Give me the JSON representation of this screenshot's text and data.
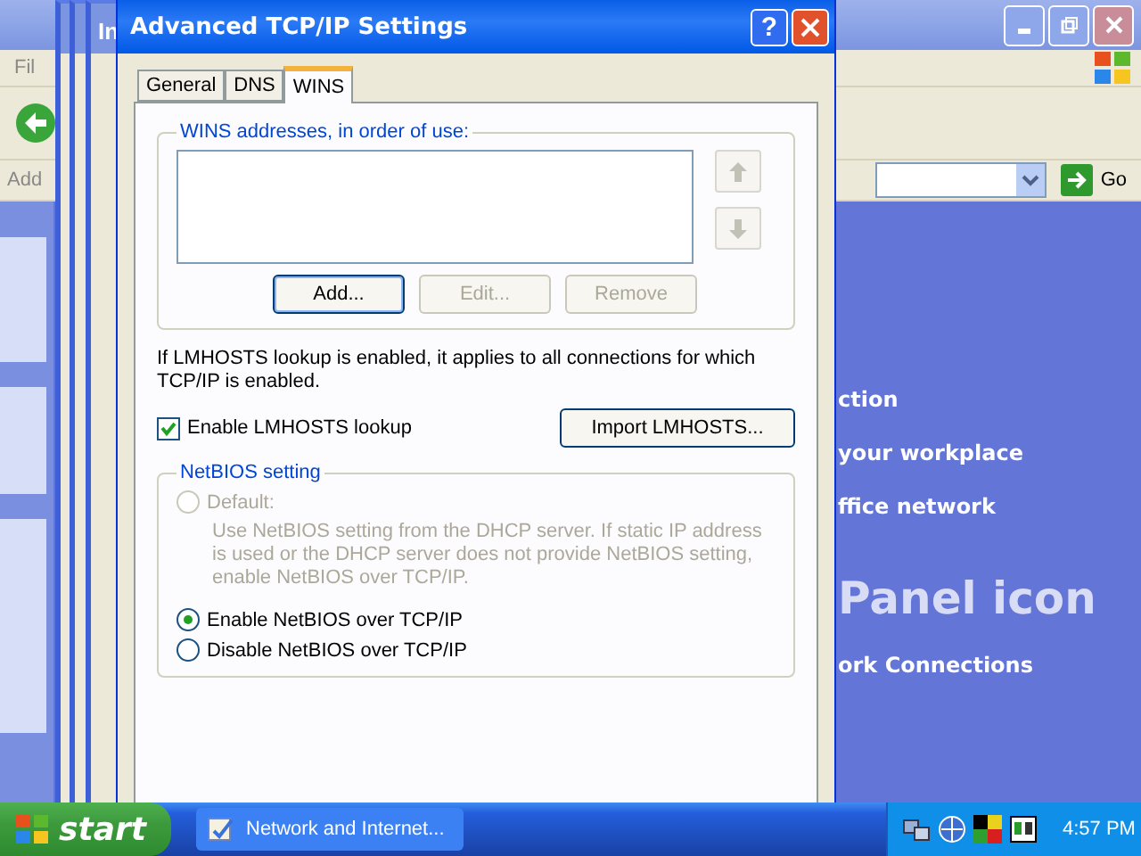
{
  "background_window": {
    "menu_fragment": "Fil",
    "address_label": "Add",
    "go_button": "Go",
    "links": [
      {
        "text": "ction"
      },
      {
        "text": "your workplace"
      },
      {
        "text": "ffice network"
      }
    ],
    "heading": "Panel icon",
    "footer_link": "ork Connections"
  },
  "stacked_window": {
    "title": "In"
  },
  "dialog": {
    "title": "Advanced TCP/IP Settings",
    "help_button": "?",
    "tabs": [
      {
        "label": "General",
        "selected": false
      },
      {
        "label": "DNS",
        "selected": false
      },
      {
        "label": "WINS",
        "selected": true
      }
    ],
    "wins_group": {
      "legend": "WINS addresses, in order of use:",
      "move_buttons": [
        {
          "kind": "up",
          "disabled": true
        },
        {
          "kind": "down",
          "disabled": true
        }
      ],
      "buttons": [
        {
          "label": "Add...",
          "disabled": false,
          "default": true
        },
        {
          "label": "Edit...",
          "disabled": true,
          "default": false
        },
        {
          "label": "Remove",
          "disabled": true,
          "default": false
        }
      ]
    },
    "lmhosts_note": "If LMHOSTS lookup is enabled, it applies to all connections for which TCP/IP is enabled.",
    "lmhosts_checkbox": {
      "label": "Enable LMHOSTS lookup",
      "checked": true
    },
    "import_button": "Import LMHOSTS...",
    "netbios": {
      "legend": "NetBIOS setting",
      "options": [
        {
          "label": "Default:",
          "description": "Use NetBIOS setting from the DHCP server. If static IP address is used or the DHCP server does not provide NetBIOS setting, enable NetBIOS over TCP/IP.",
          "selected": false,
          "disabled": true
        },
        {
          "label": "Enable NetBIOS over TCP/IP",
          "selected": true,
          "disabled": false
        },
        {
          "label": "Disable NetBIOS over TCP/IP",
          "selected": false,
          "disabled": false
        }
      ]
    }
  },
  "taskbar": {
    "start": "start",
    "task_button": "Network and Internet...",
    "clock": "4:57 PM"
  }
}
